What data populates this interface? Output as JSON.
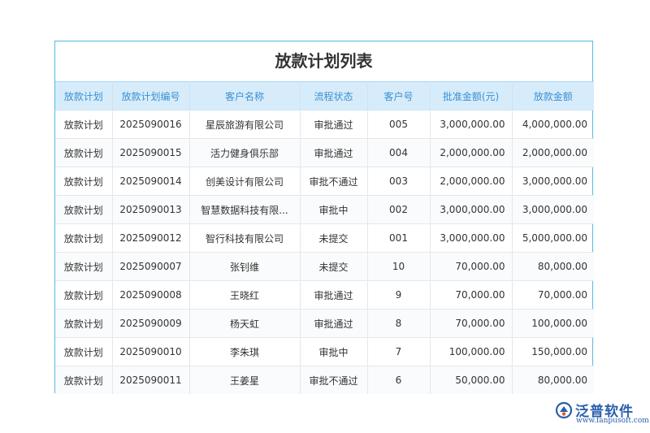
{
  "title": "放款计划列表",
  "columns": [
    "放款计划",
    "放款计划编号",
    "客户名称",
    "流程状态",
    "客户号",
    "批准金额(元)",
    "放款金额"
  ],
  "rows": [
    [
      "放款计划",
      "2025090016",
      "星辰旅游有限公司",
      "审批通过",
      "005",
      "3,000,000.00",
      "4,000,000.00"
    ],
    [
      "放款计划",
      "2025090015",
      "活力健身俱乐部",
      "审批通过",
      "004",
      "2,000,000.00",
      "2,000,000.00"
    ],
    [
      "放款计划",
      "2025090014",
      "创美设计有限公司",
      "审批不通过",
      "003",
      "2,000,000.00",
      "3,000,000.00"
    ],
    [
      "放款计划",
      "2025090013",
      "智慧数据科技有限...",
      "审批中",
      "002",
      "3,000,000.00",
      "3,000,000.00"
    ],
    [
      "放款计划",
      "2025090012",
      "智行科技有限公司",
      "未提交",
      "001",
      "3,000,000.00",
      "5,000,000.00"
    ],
    [
      "放款计划",
      "2025090007",
      "张钊维",
      "未提交",
      "10",
      "70,000.00",
      "80,000.00"
    ],
    [
      "放款计划",
      "2025090008",
      "王晓红",
      "审批通过",
      "9",
      "70,000.00",
      "70,000.00"
    ],
    [
      "放款计划",
      "2025090009",
      "杨天虹",
      "审批通过",
      "8",
      "70,000.00",
      "100,000.00"
    ],
    [
      "放款计划",
      "2025090010",
      "李朱琪",
      "审批中",
      "7",
      "100,000.00",
      "150,000.00"
    ],
    [
      "放款计划",
      "2025090011",
      "王姜星",
      "审批不通过",
      "6",
      "50,000.00",
      "80,000.00"
    ]
  ],
  "logo": {
    "name": "泛普软件",
    "url": "www.fanpusoft.com",
    "icon": "fanpu-logo-icon"
  },
  "colors": {
    "border": "#58b9de",
    "header_bg": "#d7ecfb",
    "header_text": "#3a8fd0",
    "logo": "#2b5fad"
  }
}
